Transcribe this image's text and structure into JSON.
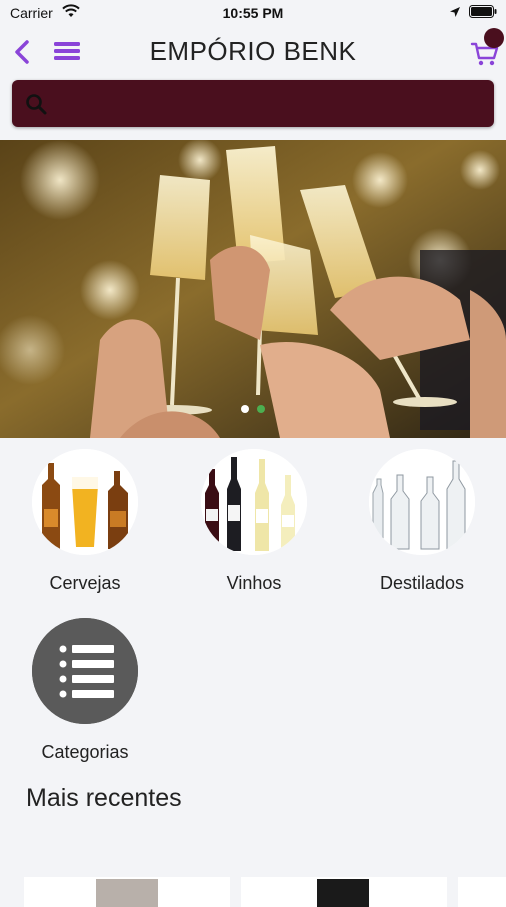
{
  "status_bar": {
    "carrier": "Carrier",
    "time": "10:55 PM"
  },
  "header": {
    "title": "EMPÓRIO BENK"
  },
  "search": {
    "placeholder": ""
  },
  "colors": {
    "accent": "#8a44d8",
    "brand": "#4a0f1e",
    "background": "#f3f4f7"
  },
  "banner": {
    "slide_count": 2,
    "active_slide": 1
  },
  "categories": [
    {
      "label": "Cervejas",
      "icon": "beer-bottles-image"
    },
    {
      "label": "Vinhos",
      "icon": "wine-bottles-image"
    },
    {
      "label": "Destilados",
      "icon": "spirits-bottles-image"
    },
    {
      "label": "Categorias",
      "icon": "list-icon"
    }
  ],
  "sections": {
    "recent_title": "Mais recentes"
  }
}
